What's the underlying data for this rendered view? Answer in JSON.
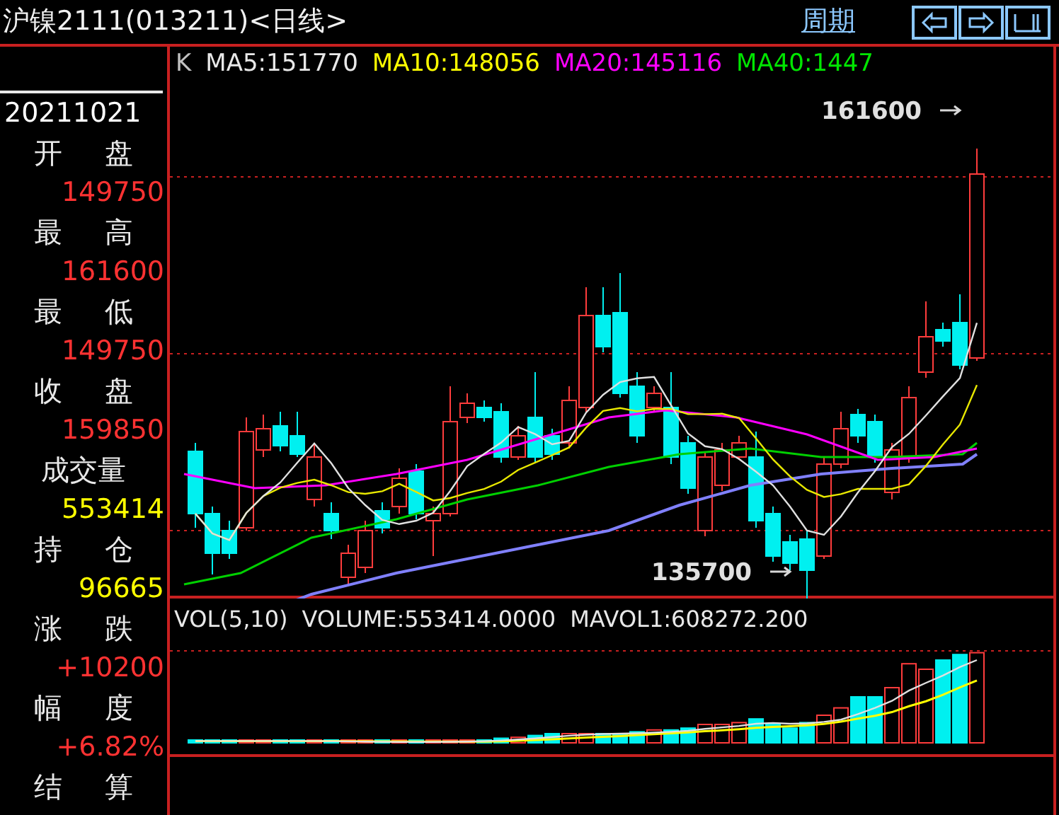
{
  "title": "沪镍2111(013211)<日线>",
  "period_link": "周期",
  "toolbar_buttons": [
    {
      "kind": "left"
    },
    {
      "kind": "right"
    },
    {
      "kind": "layout"
    }
  ],
  "info_panel": {
    "date": "20211021",
    "rows": [
      {
        "label": "开 盘",
        "value": "149750",
        "color": "#ff3232"
      },
      {
        "label": "最 高",
        "value": "161600",
        "color": "#ff3232"
      },
      {
        "label": "最 低",
        "value": "149750",
        "color": "#ff3232"
      },
      {
        "label": "收 盘",
        "value": "159850",
        "color": "#ff3232"
      },
      {
        "label": "成交量",
        "value": "553414",
        "color": "#ffff00"
      },
      {
        "label": "持 仓",
        "value": "96665",
        "color": "#ffff00"
      },
      {
        "label": "涨 跌",
        "value": "+10200",
        "color": "#ff3232"
      },
      {
        "label": "幅 度",
        "value": "+6.82%",
        "color": "#ff3232"
      },
      {
        "label": "结 算"
      }
    ]
  },
  "price_chart": {
    "legend": [
      {
        "text": "K",
        "color": "#c0c0c0"
      },
      {
        "text": "MA5:151770",
        "color": "#e8e8e8"
      },
      {
        "text": "MA10:148056",
        "color": "#ffff00"
      },
      {
        "text": "MA20:145116",
        "color": "#ff00ff"
      },
      {
        "text": "MA40:1447",
        "color": "#00e600"
      }
    ],
    "high_marker": "161600",
    "low_marker": "135700"
  },
  "volume_chart": {
    "legend": [
      {
        "text": "VOL(5,10)"
      },
      {
        "text": "VOLUME:553414.0000"
      },
      {
        "text": "MAVOL1:608272.200"
      }
    ]
  }
}
